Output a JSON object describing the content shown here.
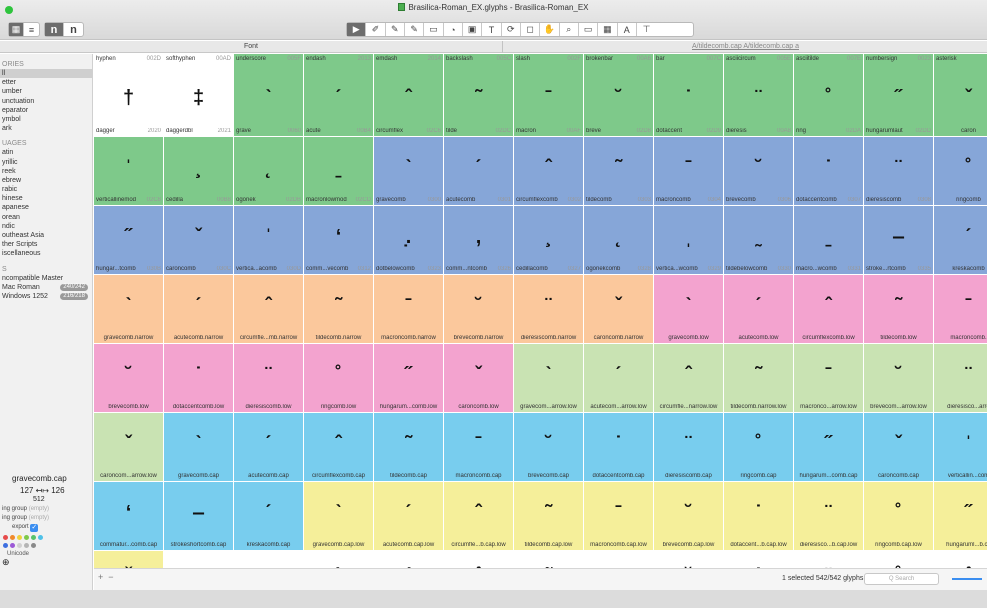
{
  "window": {
    "title": "Brasilica-Roman_EX.glyphs - Brasilica-Roman_EX",
    "traffic_colors": [
      "#2ec43d"
    ]
  },
  "toolbar": {
    "view_buttons": [
      "grid-view",
      "list-view"
    ],
    "text_buttons": [
      "n",
      "n"
    ],
    "tools": [
      "▶",
      "✐",
      "✎",
      "✎",
      "▭",
      "◔",
      "▣",
      "T",
      "⊙",
      "◻",
      "✋",
      "🔍",
      "▭",
      "▦",
      "A",
      "⊤"
    ]
  },
  "tabs": {
    "font": "Font",
    "edit": "A/tildecomb.cap A/tildecomb.cap a"
  },
  "sidebar": {
    "categories_header": "ORIES",
    "categories": [
      "ll",
      "etter",
      "umber",
      "unctuation",
      "eparator",
      "ymbol",
      "ark"
    ],
    "languages_header": "UAGES",
    "languages": [
      "atin",
      "yrillic",
      "reek",
      "ebrew",
      "rabic",
      "hinese",
      "apanese",
      "orean",
      "ndic",
      "outheast Asia",
      "ther Scripts",
      "iscellaneous"
    ],
    "filters_header": "S",
    "filters": [
      {
        "label": "ncompatible Master",
        "badge": ""
      },
      {
        "label": "Mac Roman",
        "badge": "240/242"
      },
      {
        "label": "Windows 1252",
        "badge": "216/218"
      }
    ]
  },
  "info": {
    "glyph_name": "gravecomb.cap",
    "lsb": "127",
    "rsb": "126",
    "width": "512",
    "left_group_label": "ing group",
    "left_group_value": "(empty)",
    "right_group_label": "ing group",
    "right_group_value": "(empty)",
    "export_label": "export",
    "unicode_label": "Unicode",
    "color_dots": [
      "#e64b4b",
      "#f08a2c",
      "#f0d23c",
      "#7ec94a",
      "#57c36b",
      "#4fc1e8",
      "#3d6fe0",
      "#9b59d6",
      "#d0d0d0",
      "#b5b5b5",
      "#8a8a8a"
    ]
  },
  "colors": {
    "white": "#ffffff",
    "green": "#7ec98a",
    "blue": "#86a6d8",
    "orange": "#fbc89c",
    "pink": "#f3a3cf",
    "lightgreen": "#c9e3b3",
    "cyan": "#78cdee",
    "yellow": "#f5ef9a"
  },
  "rows": [
    [
      {
        "n": "dagger",
        "u": "2020",
        "g": "†",
        "c": "white",
        "t": "hyphen",
        "tu": "002D"
      },
      {
        "n": "daggerdbl",
        "u": "2021",
        "g": "‡",
        "c": "white",
        "t": "softhyphen",
        "tu": "00AD"
      },
      {
        "n": "grave",
        "u": "0060",
        "g": "ˋ",
        "c": "green",
        "t": "underscore",
        "tu": "005F"
      },
      {
        "n": "acute",
        "u": "00B4",
        "g": "ˊ",
        "c": "green",
        "t": "endash",
        "tu": "2013"
      },
      {
        "n": "circumflex",
        "u": "02C6",
        "g": "ˆ",
        "c": "green",
        "t": "emdash",
        "tu": "2014"
      },
      {
        "n": "tilde",
        "u": "02DC",
        "g": "˜",
        "c": "green",
        "t": "backslash",
        "tu": "005C"
      },
      {
        "n": "macron",
        "u": "00AF",
        "g": "ˉ",
        "c": "green",
        "t": "slash",
        "tu": "002F"
      },
      {
        "n": "breve",
        "u": "02D8",
        "g": "˘",
        "c": "green",
        "t": "brokenbar",
        "tu": "00A6"
      },
      {
        "n": "dotaccent",
        "u": "02D9",
        "g": "˙",
        "c": "green",
        "t": "bar",
        "tu": "007C"
      },
      {
        "n": "dieresis",
        "u": "00A8",
        "g": "¨",
        "c": "green",
        "t": "asciicircum",
        "tu": "005E"
      },
      {
        "n": "ring",
        "u": "02DA",
        "g": "˚",
        "c": "green",
        "t": "asciitilde",
        "tu": "007E"
      },
      {
        "n": "hungarumlaut",
        "u": "02DD",
        "g": "˝",
        "c": "green",
        "t": "numbersign",
        "tu": "0023"
      },
      {
        "n": "caron",
        "u": "",
        "g": "ˇ",
        "c": "green",
        "t": "asterisk",
        "tu": ""
      }
    ],
    [
      {
        "n": "verticallinemod",
        "u": "02C8",
        "g": "ˈ",
        "c": "green"
      },
      {
        "n": "cedilla",
        "u": "00B8",
        "g": "¸",
        "c": "green"
      },
      {
        "n": "ogonek",
        "u": "02DB",
        "g": "˛",
        "c": "green"
      },
      {
        "n": "macronlowmod",
        "u": "02CD",
        "g": "ˍ",
        "c": "green"
      },
      {
        "n": "gravecomb",
        "u": "0300",
        "g": "ˋ",
        "c": "blue"
      },
      {
        "n": "acutecomb",
        "u": "0301",
        "g": "ˊ",
        "c": "blue"
      },
      {
        "n": "circumflexcomb",
        "u": "0302",
        "g": "ˆ",
        "c": "blue"
      },
      {
        "n": "tildecomb",
        "u": "0303",
        "g": "˜",
        "c": "blue"
      },
      {
        "n": "macroncomb",
        "u": "0304",
        "g": "ˉ",
        "c": "blue"
      },
      {
        "n": "brevecomb",
        "u": "0306",
        "g": "˘",
        "c": "blue"
      },
      {
        "n": "dotaccentcomb",
        "u": "0307",
        "g": "˙",
        "c": "blue"
      },
      {
        "n": "dieresiscomb",
        "u": "0308",
        "g": "¨",
        "c": "blue"
      },
      {
        "n": "ringcomb",
        "u": "",
        "g": "˚",
        "c": "blue"
      }
    ],
    [
      {
        "n": "hungar...tcomb",
        "u": "030B",
        "g": "˝",
        "c": "blue"
      },
      {
        "n": "caroncomb",
        "u": "030C",
        "g": "ˇ",
        "c": "blue"
      },
      {
        "n": "vertica...acomb",
        "u": "030D",
        "g": "ˈ",
        "c": "blue"
      },
      {
        "n": "comm...vecomb",
        "u": "0312",
        "g": "‘",
        "c": "blue"
      },
      {
        "n": "dotbelowcomb",
        "u": "0323",
        "g": "̣.",
        "c": "blue"
      },
      {
        "n": "comm...ntcomb",
        "u": "0326",
        "g": ",",
        "c": "blue"
      },
      {
        "n": "cedillacomb",
        "u": "0327",
        "g": "¸",
        "c": "blue"
      },
      {
        "n": "ogonekcomb",
        "u": "0328",
        "g": "˛",
        "c": "blue"
      },
      {
        "n": "vertica...wcomb",
        "u": "0329",
        "g": "ˌ",
        "c": "blue"
      },
      {
        "n": "tildebelowcomb",
        "u": "0330",
        "g": "˷",
        "c": "blue"
      },
      {
        "n": "macro...wcomb",
        "u": "0331",
        "g": "ˍ",
        "c": "blue"
      },
      {
        "n": "stroke...rtcomb",
        "u": "0335",
        "g": "‒",
        "c": "blue"
      },
      {
        "n": "kreskacomb",
        "u": "",
        "g": "ˊ",
        "c": "blue"
      }
    ],
    [
      {
        "n": "gravecomb.narrow",
        "u": "",
        "g": "ˋ",
        "c": "orange"
      },
      {
        "n": "acutecomb.narrow",
        "u": "",
        "g": "ˊ",
        "c": "orange"
      },
      {
        "n": "circumfle...mb.narrow",
        "u": "",
        "g": "ˆ",
        "c": "orange"
      },
      {
        "n": "tildecomb.narrow",
        "u": "",
        "g": "˜",
        "c": "orange"
      },
      {
        "n": "macroncomb.narrow",
        "u": "",
        "g": "ˉ",
        "c": "orange"
      },
      {
        "n": "brevecomb.narrow",
        "u": "",
        "g": "˘",
        "c": "orange"
      },
      {
        "n": "dieresiscomb.narrow",
        "u": "",
        "g": "¨",
        "c": "orange"
      },
      {
        "n": "caroncomb.narrow",
        "u": "",
        "g": "ˇ",
        "c": "orange"
      },
      {
        "n": "gravecomb.low",
        "u": "",
        "g": "ˋ",
        "c": "pink"
      },
      {
        "n": "acutecomb.low",
        "u": "",
        "g": "ˊ",
        "c": "pink"
      },
      {
        "n": "circumflexcomb.low",
        "u": "",
        "g": "ˆ",
        "c": "pink"
      },
      {
        "n": "tildecomb.low",
        "u": "",
        "g": "˜",
        "c": "pink"
      },
      {
        "n": "macroncomb.",
        "u": "",
        "g": "ˉ",
        "c": "pink"
      }
    ],
    [
      {
        "n": "brevecomb.low",
        "u": "",
        "g": "˘",
        "c": "pink"
      },
      {
        "n": "dotaccentcomb.low",
        "u": "",
        "g": "˙",
        "c": "pink"
      },
      {
        "n": "dieresiscomb.low",
        "u": "",
        "g": "¨",
        "c": "pink"
      },
      {
        "n": "ringcomb.low",
        "u": "",
        "g": "˚",
        "c": "pink"
      },
      {
        "n": "hungarum...comb.low",
        "u": "",
        "g": "˝",
        "c": "pink"
      },
      {
        "n": "caroncomb.low",
        "u": "",
        "g": "ˇ",
        "c": "pink"
      },
      {
        "n": "gravecom...arrow.low",
        "u": "",
        "g": "ˋ",
        "c": "lightgreen"
      },
      {
        "n": "acutecom...arrow.low",
        "u": "",
        "g": "ˊ",
        "c": "lightgreen"
      },
      {
        "n": "circumfle...narrow.low",
        "u": "",
        "g": "ˆ",
        "c": "lightgreen"
      },
      {
        "n": "tildecomb.narrow.low",
        "u": "",
        "g": "˜",
        "c": "lightgreen"
      },
      {
        "n": "macronco...arrow.low",
        "u": "",
        "g": "ˉ",
        "c": "lightgreen"
      },
      {
        "n": "brevecom...arrow.low",
        "u": "",
        "g": "˘",
        "c": "lightgreen"
      },
      {
        "n": "dieresisco...arro",
        "u": "",
        "g": "¨",
        "c": "lightgreen"
      }
    ],
    [
      {
        "n": "caroncom...arrow.low",
        "u": "",
        "g": "ˇ",
        "c": "lightgreen"
      },
      {
        "n": "gravecomb.cap",
        "u": "",
        "g": "ˋ",
        "c": "cyan"
      },
      {
        "n": "acutecomb.cap",
        "u": "",
        "g": "ˊ",
        "c": "cyan"
      },
      {
        "n": "circumflexcomb.cap",
        "u": "",
        "g": "ˆ",
        "c": "cyan"
      },
      {
        "n": "tildecomb.cap",
        "u": "",
        "g": "˜",
        "c": "cyan"
      },
      {
        "n": "macroncomb.cap",
        "u": "",
        "g": "ˉ",
        "c": "cyan"
      },
      {
        "n": "brevecomb.cap",
        "u": "",
        "g": "˘",
        "c": "cyan"
      },
      {
        "n": "dotaccentcomb.cap",
        "u": "",
        "g": "˙",
        "c": "cyan"
      },
      {
        "n": "dieresiscomb.cap",
        "u": "",
        "g": "¨",
        "c": "cyan"
      },
      {
        "n": "ringcomb.cap",
        "u": "",
        "g": "˚",
        "c": "cyan"
      },
      {
        "n": "hungarum...comb.cap",
        "u": "",
        "g": "˝",
        "c": "cyan"
      },
      {
        "n": "caroncomb.cap",
        "u": "",
        "g": "ˇ",
        "c": "cyan"
      },
      {
        "n": "verticallin...com",
        "u": "",
        "g": "ˈ",
        "c": "cyan"
      }
    ],
    [
      {
        "n": "commatur...comb.cap",
        "u": "",
        "g": "‘",
        "c": "cyan"
      },
      {
        "n": "strokeshortcomb.cap",
        "u": "",
        "g": "‒",
        "c": "cyan"
      },
      {
        "n": "kreskacomb.cap",
        "u": "",
        "g": "ˊ",
        "c": "cyan"
      },
      {
        "n": "gravecomb.cap.low",
        "u": "",
        "g": "ˋ",
        "c": "yellow"
      },
      {
        "n": "acutecomb.cap.low",
        "u": "",
        "g": "ˊ",
        "c": "yellow"
      },
      {
        "n": "circumfle...b.cap.low",
        "u": "",
        "g": "ˆ",
        "c": "yellow"
      },
      {
        "n": "tildecomb.cap.low",
        "u": "",
        "g": "˜",
        "c": "yellow"
      },
      {
        "n": "macroncomb.cap.low",
        "u": "",
        "g": "ˉ",
        "c": "yellow"
      },
      {
        "n": "brevecomb.cap.low",
        "u": "",
        "g": "˘",
        "c": "yellow"
      },
      {
        "n": "dotaccent...b.cap.low",
        "u": "",
        "g": "˙",
        "c": "yellow"
      },
      {
        "n": "dieresisco...b.cap.low",
        "u": "",
        "g": "¨",
        "c": "yellow"
      },
      {
        "n": "ringcomb.cap.low",
        "u": "",
        "g": "˚",
        "c": "yellow"
      },
      {
        "n": "hungaruml...b.ca",
        "u": "",
        "g": "˝",
        "c": "yellow"
      }
    ],
    [
      {
        "n": "",
        "u": "",
        "g": "ˇ",
        "c": "yellow"
      },
      {
        "n": "",
        "u": "",
        "g": "ˌ",
        "c": "white"
      },
      {
        "n": "",
        "u": "",
        "g": "ˍ",
        "c": "white"
      },
      {
        "n": "",
        "u": "",
        "g": "ˋ",
        "c": "white"
      },
      {
        "n": "",
        "u": "",
        "g": "ˊ",
        "c": "white"
      },
      {
        "n": "",
        "u": "",
        "g": "ˆ",
        "c": "white"
      },
      {
        "n": "",
        "u": "",
        "g": "˜",
        "c": "white"
      },
      {
        "n": "",
        "u": "",
        "g": "ˉ",
        "c": "white"
      },
      {
        "n": "",
        "u": "",
        "g": "˘",
        "c": "white"
      },
      {
        "n": "",
        "u": "",
        "g": "˙",
        "c": "white"
      },
      {
        "n": "",
        "u": "",
        "g": "¨",
        "c": "white"
      },
      {
        "n": "",
        "u": "",
        "g": "˚",
        "c": "white"
      },
      {
        "n": "",
        "u": "",
        "g": "ˆ",
        "c": "white"
      }
    ]
  ],
  "bottom": {
    "status": "1 selected 542/542 glyphs",
    "search_placeholder": "Q  Search",
    "plus": "+",
    "minus": "−"
  }
}
